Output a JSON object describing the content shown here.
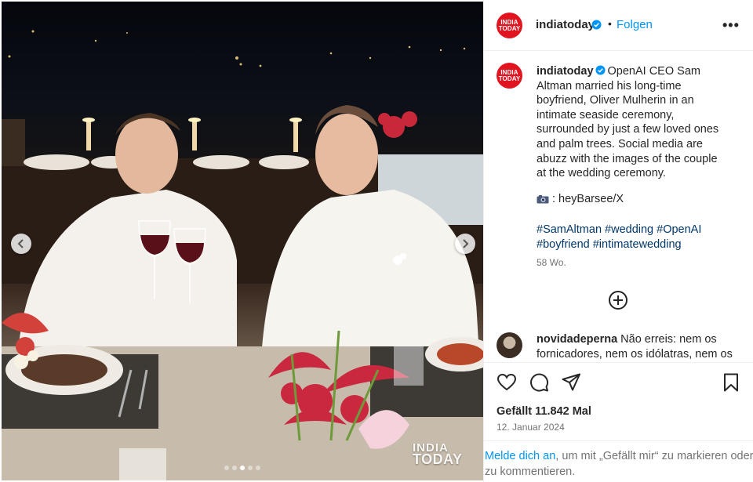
{
  "post": {
    "username": "indiatoday",
    "verified": true,
    "follow_label": "Folgen",
    "separator": "•",
    "more_label": "•••",
    "avatar_logo": {
      "line1": "INDIA",
      "line2": "TODAY",
      "color": "#e2141f"
    },
    "caption_text": "OpenAI CEO Sam Altman married his long-time boyfriend, Oliver Mulherin in an intimate seaside ceremony, surrounded by just a few loved ones and palm trees. Social media are abuzz with the images of the couple at the wedding ceremony.",
    "credit_icon": "camera-emoji",
    "credit_text": ": heyBarsee/X",
    "hashtags": "#SamAltman #wedding #OpenAI #boyfriend #intimatewedding",
    "age": "58 Wo.",
    "load_more_icon": "plus-circle-icon"
  },
  "comment": {
    "username": "novidadeperna",
    "text": "Não erreis: nem os fornicadores, nem os idólatras, nem os"
  },
  "actions": {
    "icons": [
      "heart-icon",
      "comment-icon",
      "share-icon",
      "bookmark-icon"
    ],
    "likes_text": "Gefällt 11.842 Mal",
    "date_text": "12. Januar 2024"
  },
  "login_prompt": {
    "link_text": "Melde dich an",
    "rest_text": ", um mit „Gefällt mir“ zu markieren oder zu kommentieren."
  },
  "media": {
    "carousel_total": 5,
    "carousel_active_index": 2,
    "watermark_line1": "INDIA",
    "watermark_line2": "TODAY",
    "prev_icon": "chevron-left-icon",
    "next_icon": "chevron-right-icon"
  },
  "colors": {
    "link_blue": "#0095f6",
    "hashtag_blue": "#00376b",
    "text": "#262626",
    "muted": "#737373",
    "verified_blue": "#0095f6"
  }
}
